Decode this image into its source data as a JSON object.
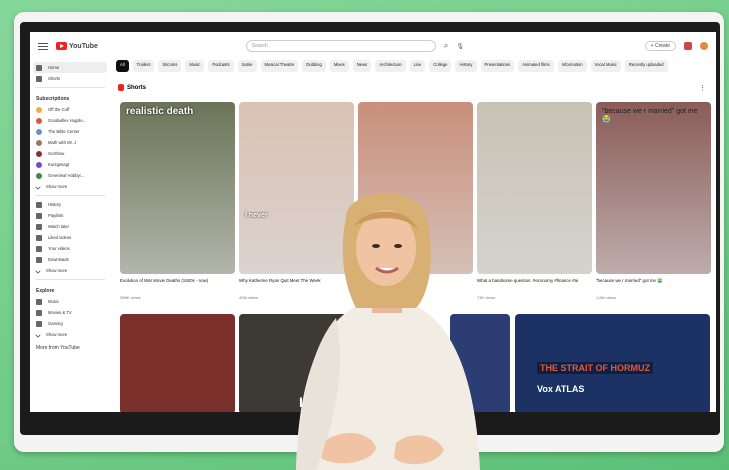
{
  "topbar": {
    "logo": "YouTube",
    "search_placeholder": "Search",
    "create_label": "+ Create"
  },
  "chips": [
    "All",
    "Trailers",
    "Sitcoms",
    "Music",
    "Podcasts",
    "Satire",
    "Musical Theatre",
    "Dubbing",
    "Mixes",
    "News",
    "Architecture",
    "Live",
    "College",
    "History",
    "Presentations",
    "Animated films",
    "Information",
    "Vocal Music",
    "Recently uploaded"
  ],
  "sidebar": {
    "top": [
      {
        "label": "Home",
        "icon": "home-icon"
      },
      {
        "label": "Shorts",
        "icon": "shorts-icon"
      }
    ],
    "subscriptions_title": "Subscriptions",
    "channels": [
      {
        "label": "Off the Cuff",
        "color": "#f0b040"
      },
      {
        "label": "Goodwillex Hugsle...",
        "color": "#d85a3a"
      },
      {
        "label": "The Bible Center",
        "color": "#6b8fcf"
      },
      {
        "label": "Math with Mr. J",
        "color": "#9a7a5a"
      },
      {
        "label": "SciShow",
        "color": "#8b2f2f"
      },
      {
        "label": "Kurzgesagt",
        "color": "#6a4fd0"
      },
      {
        "label": "Greenleaf Hobbyi...",
        "color": "#3a8a4a"
      }
    ],
    "show_more": "Show more",
    "you_items": [
      "History",
      "Playlists",
      "Watch later",
      "Liked videos",
      "Your videos",
      "Downloads"
    ],
    "show_more_2": "Show more",
    "explore_title": "Explore",
    "explore_items": [
      "Music",
      "Movies & TV",
      "Gaming"
    ],
    "show_more_3": "Show more",
    "more_from": "More from YouTube"
  },
  "shorts": {
    "title": "Shorts",
    "items": [
      {
        "overlay": "realistic death",
        "caption": "Evolution of War Movie Deaths (1920s - now)",
        "views": "398K views",
        "bg": "#6b7458"
      },
      {
        "overlay": "I never",
        "caption": "Why Katherine Ryan Quit Meet The Week",
        "views": "40M views",
        "bg": "#d9c2b4"
      },
      {
        "overlay": "RATED SOR",
        "caption": "",
        "views": "",
        "bg": "#c98f7a"
      },
      {
        "overlay": "",
        "caption": "What a handsome question. #economy #finance #ai",
        "views": "73K views",
        "bg": "#c8c2b4"
      },
      {
        "overlay": "\"because we r married\" got me 😭",
        "caption": "\"because we r married\" got me 😭",
        "views": "1.6M views",
        "bg": "#8a5c58"
      }
    ]
  },
  "row2": [
    {
      "label": "",
      "bg": "#7a2f2a"
    },
    {
      "label": "LORNE",
      "bg": "#3d3935"
    },
    {
      "label": "",
      "bg": "#2b3d73"
    },
    {
      "label": "THE STRAIT OF HORMUZ",
      "sub": "Vox ATLAS",
      "bg": "#1c3264"
    }
  ]
}
